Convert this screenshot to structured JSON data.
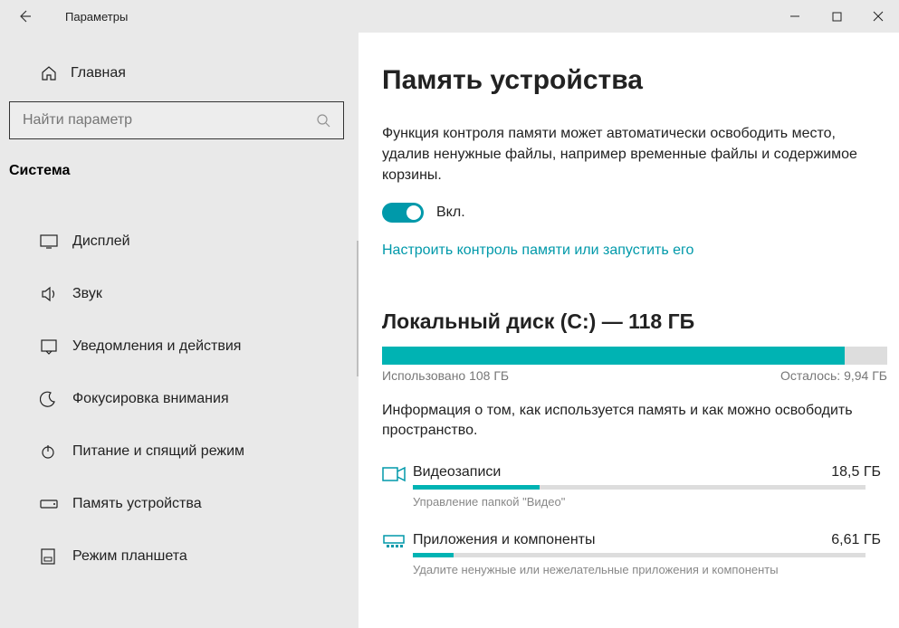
{
  "window": {
    "title": "Параметры"
  },
  "sidebar": {
    "home": "Главная",
    "search_placeholder": "Найти параметр",
    "category": "Система",
    "items": [
      {
        "label": "Дисплей"
      },
      {
        "label": "Звук"
      },
      {
        "label": "Уведомления и действия"
      },
      {
        "label": "Фокусировка внимания"
      },
      {
        "label": "Питание и спящий режим"
      },
      {
        "label": "Память устройства"
      },
      {
        "label": "Режим планшета"
      }
    ]
  },
  "content": {
    "title": "Память устройства",
    "description": "Функция контроля памяти может автоматически освободить место, удалив ненужные файлы, например временные файлы и содержимое корзины.",
    "toggle_label": "Вкл.",
    "configure_link": "Настроить контроль памяти или запустить его",
    "disk": {
      "title": "Локальный диск (C:) — 118 ГБ",
      "used_label": "Использовано 108 ГБ",
      "free_label": "Осталось: 9,94 ГБ",
      "fill_pct": 91.5
    },
    "disk_description": "Информация о том, как используется память и как можно освободить пространство.",
    "categories": [
      {
        "name": "Видеозаписи",
        "size": "18,5 ГБ",
        "sub": "Управление папкой \"Видео\"",
        "fill_pct": 28
      },
      {
        "name": "Приложения и компоненты",
        "size": "6,61 ГБ",
        "sub": "Удалите ненужные или нежелательные приложения и компоненты",
        "fill_pct": 9
      }
    ]
  }
}
